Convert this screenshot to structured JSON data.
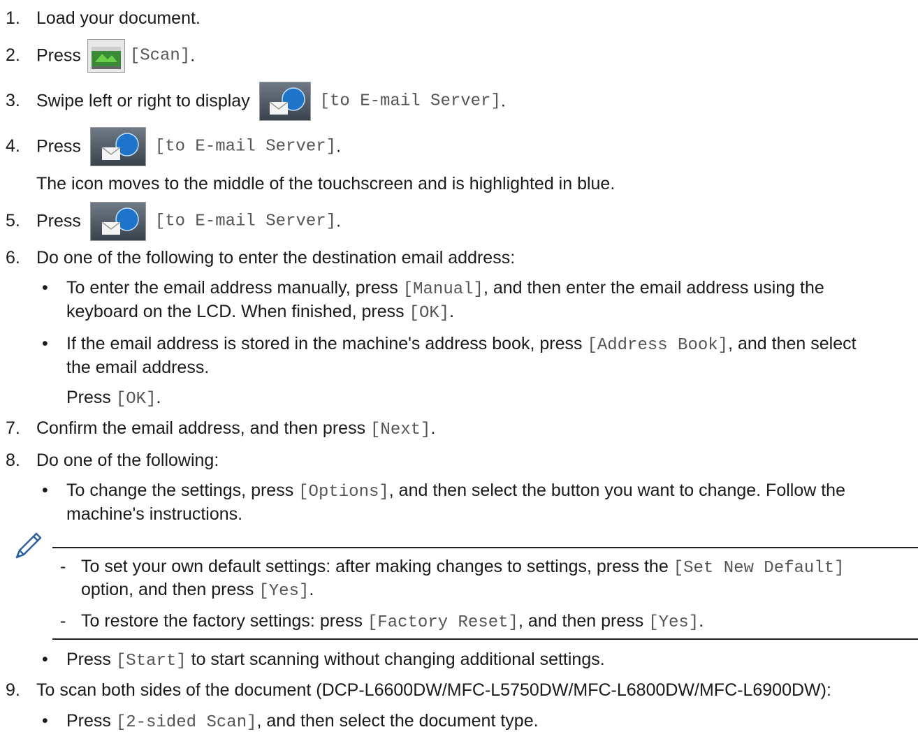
{
  "steps": {
    "s1": {
      "num": "1.",
      "text": "Load your document."
    },
    "s2": {
      "num": "2.",
      "pre": "Press",
      "code": "[Scan]",
      "post": "."
    },
    "s3": {
      "num": "3.",
      "pre": "Swipe left or right to display",
      "code": "[to E-mail Server]",
      "post": "."
    },
    "s4": {
      "num": "4.",
      "pre": "Press",
      "code": "[to E-mail Server]",
      "post": ".",
      "note": "The icon moves to the middle of the touchscreen and is highlighted in blue."
    },
    "s5": {
      "num": "5.",
      "pre": "Press",
      "code": "[to E-mail Server]",
      "post": "."
    },
    "s6": {
      "num": "6.",
      "text": "Do one of the following to enter the destination email address:",
      "b1": {
        "a": "To enter the email address manually, press ",
        "code1": "[Manual]",
        "b": ", and then enter the email address using the",
        "line2": "keyboard on the LCD. When finished, press ",
        "code2": "[OK]",
        "end": "."
      },
      "b2": {
        "a": "If the email address is stored in the machine's address book, press ",
        "code1": "[Address Book]",
        "b": ", and then select",
        "line2": "the email address.",
        "press": "Press ",
        "code2": "[OK]",
        "end": "."
      }
    },
    "s7": {
      "num": "7.",
      "pre": "Confirm the email address, and then press ",
      "code": "[Next]",
      "post": "."
    },
    "s8": {
      "num": "8.",
      "text": "Do one of the following:",
      "b1": {
        "a": "To change the settings, press ",
        "code": "[Options]",
        "b": ", and then select the button you want to change. Follow the",
        "line2": "machine's instructions."
      },
      "note": {
        "n1": {
          "dash": "-",
          "a": "To set your own default settings: after making changes to settings, press the ",
          "code1": "[Set New Default]",
          "line2": "option, and then press ",
          "code2": "[Yes]",
          "end": "."
        },
        "n2": {
          "dash": "-",
          "a": "To restore the factory settings: press ",
          "code1": "[Factory Reset]",
          "b": ", and then press ",
          "code2": "[Yes]",
          "end": "."
        }
      },
      "b2": {
        "a": "Press ",
        "code": "[Start]",
        "b": " to start scanning without changing additional settings."
      }
    },
    "s9": {
      "num": "9.",
      "text": "To scan both sides of the document (DCP-L6600DW/MFC-L5750DW/MFC-L6800DW/MFC-L6900DW):",
      "b1": {
        "a": "Press ",
        "code": "[2-sided Scan]",
        "b": ", and then select the document type."
      }
    }
  },
  "bullet_char": "•",
  "icons": {
    "scan": "scanner-icon",
    "email": "email-server-icon",
    "note": "pencil-icon"
  }
}
